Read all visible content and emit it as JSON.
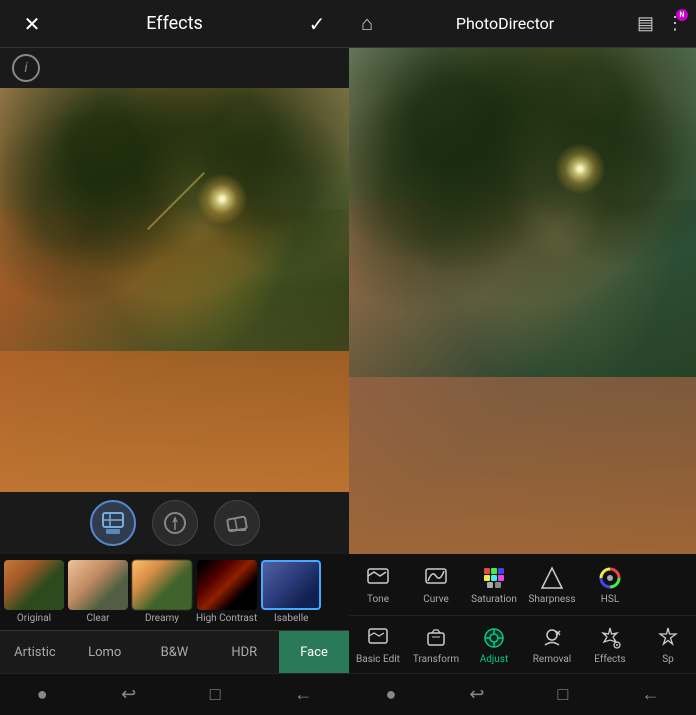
{
  "left": {
    "header": {
      "title": "Effects",
      "close_label": "✕",
      "check_label": "✓"
    },
    "info_icon": "i",
    "tool_icons": [
      {
        "name": "brush-tool",
        "active": true
      },
      {
        "name": "pen-tool",
        "active": false
      },
      {
        "name": "eraser-tool",
        "active": false
      }
    ],
    "filters": [
      {
        "id": "original",
        "label": "Original",
        "selected": false,
        "class": "ft-original"
      },
      {
        "id": "clear",
        "label": "Clear",
        "selected": false,
        "class": "ft-clear"
      },
      {
        "id": "dreamy",
        "label": "Dreamy",
        "selected": false,
        "class": "ft-dreamy"
      },
      {
        "id": "high-contrast",
        "label": "High Contrast",
        "selected": false,
        "class": "ft-highcontrast"
      },
      {
        "id": "isabelle",
        "label": "Isabelle",
        "selected": true,
        "class": "ft-isabelle"
      }
    ],
    "categories": [
      {
        "id": "artistic",
        "label": "Artistic",
        "active": false
      },
      {
        "id": "lomo",
        "label": "Lomo",
        "active": false
      },
      {
        "id": "bw",
        "label": "B&W",
        "active": false
      },
      {
        "id": "hdr",
        "label": "HDR",
        "active": false
      },
      {
        "id": "face",
        "label": "Face",
        "active": true
      }
    ],
    "bottom_nav": [
      {
        "name": "dot-nav",
        "icon": "●"
      },
      {
        "name": "back-arrow-nav",
        "icon": "↩"
      },
      {
        "name": "square-nav",
        "icon": "□"
      },
      {
        "name": "home-nav",
        "icon": "←"
      }
    ]
  },
  "right": {
    "header": {
      "home_icon": "⌂",
      "title": "PhotoDirector",
      "album_icon": "▤",
      "menu_icon": "⋮",
      "notif_letter": "N"
    },
    "tools": [
      {
        "id": "tone",
        "label": "Tone",
        "active": false
      },
      {
        "id": "curve",
        "label": "Curve",
        "active": false
      },
      {
        "id": "saturation",
        "label": "Saturation",
        "active": false
      },
      {
        "id": "sharpness",
        "label": "Sharpness",
        "active": false
      },
      {
        "id": "hsl",
        "label": "HSL",
        "active": false
      }
    ],
    "actions": [
      {
        "id": "basic-edit",
        "label": "Basic Edit",
        "active": false
      },
      {
        "id": "transform",
        "label": "Transform",
        "active": false
      },
      {
        "id": "adjust",
        "label": "Adjust",
        "active": true
      },
      {
        "id": "removal",
        "label": "Removal",
        "active": false
      },
      {
        "id": "effects",
        "label": "Effects",
        "active": false
      },
      {
        "id": "sp",
        "label": "Sp",
        "active": false
      }
    ],
    "bottom_nav": [
      {
        "name": "dot-nav-r",
        "icon": "●"
      },
      {
        "name": "back-arrow-nav-r",
        "icon": "↩"
      },
      {
        "name": "square-nav-r",
        "icon": "□"
      },
      {
        "name": "home-nav-r",
        "icon": "←"
      }
    ]
  }
}
